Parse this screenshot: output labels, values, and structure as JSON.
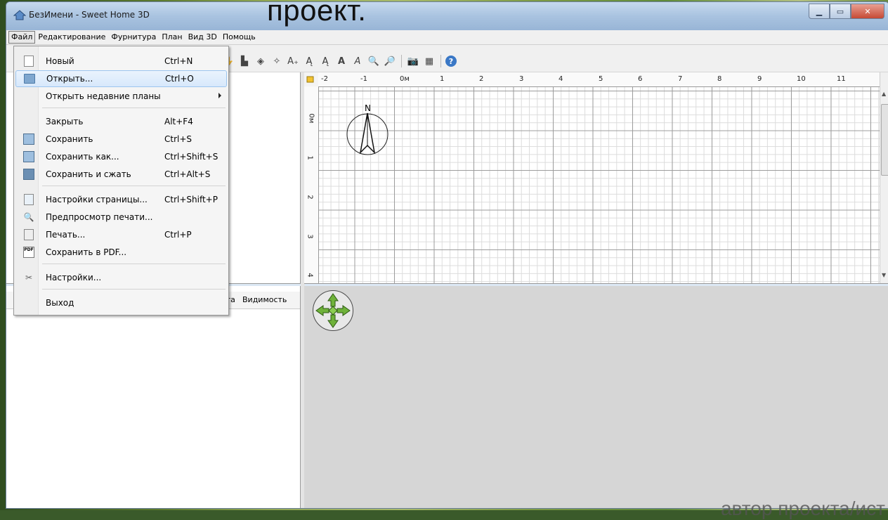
{
  "window": {
    "title": "БезИмени - Sweet Home 3D"
  },
  "overlay_caption": "проект.",
  "overlay_bottom_text": "автор проекта/ист",
  "menubar": {
    "items": [
      "Файл",
      "Редактирование",
      "Фурнитура",
      "План",
      "Вид 3D",
      "Помощь"
    ]
  },
  "file_menu": {
    "items": [
      {
        "label": "Новый",
        "shortcut": "Ctrl+N",
        "icon": "new-document-icon"
      },
      {
        "label": "Открыть...",
        "shortcut": "Ctrl+O",
        "icon": "open-folder-icon",
        "highlighted": true
      },
      {
        "label": "Открыть недавние планы",
        "shortcut": "",
        "icon": "",
        "submenu": true
      },
      {
        "label": "Закрыть",
        "shortcut": "Alt+F4",
        "icon": ""
      },
      {
        "label": "Сохранить",
        "shortcut": "Ctrl+S",
        "icon": "save-icon"
      },
      {
        "label": "Сохранить как...",
        "shortcut": "Ctrl+Shift+S",
        "icon": "save-as-icon"
      },
      {
        "label": "Сохранить и сжать",
        "shortcut": "Ctrl+Alt+S",
        "icon": "save-compress-icon"
      },
      {
        "label": "Настройки страницы...",
        "shortcut": "Ctrl+Shift+P",
        "icon": "page-setup-icon"
      },
      {
        "label": "Предпросмотр печати...",
        "shortcut": "",
        "icon": "print-preview-icon"
      },
      {
        "label": "Печать...",
        "shortcut": "Ctrl+P",
        "icon": "print-icon"
      },
      {
        "label": "Сохранить в PDF...",
        "shortcut": "",
        "icon": "pdf-icon"
      },
      {
        "label": "Настройки...",
        "shortcut": "",
        "icon": "preferences-icon"
      },
      {
        "label": "Выход",
        "shortcut": "",
        "icon": ""
      }
    ]
  },
  "furniture_table": {
    "headers": [
      "ота",
      "Видимость"
    ]
  },
  "plan": {
    "top_ruler": [
      "-2",
      "-1",
      "0м",
      "1",
      "2",
      "3",
      "4",
      "5",
      "6",
      "7",
      "8",
      "9",
      "10",
      "11"
    ],
    "left_ruler": [
      "0м",
      "1",
      "2",
      "3",
      "4"
    ],
    "compass_label": "N"
  },
  "colors": {
    "accent": "#3a78c6",
    "nav_green": "#6fb23a",
    "menu_highlight": "#d7e8fb"
  }
}
